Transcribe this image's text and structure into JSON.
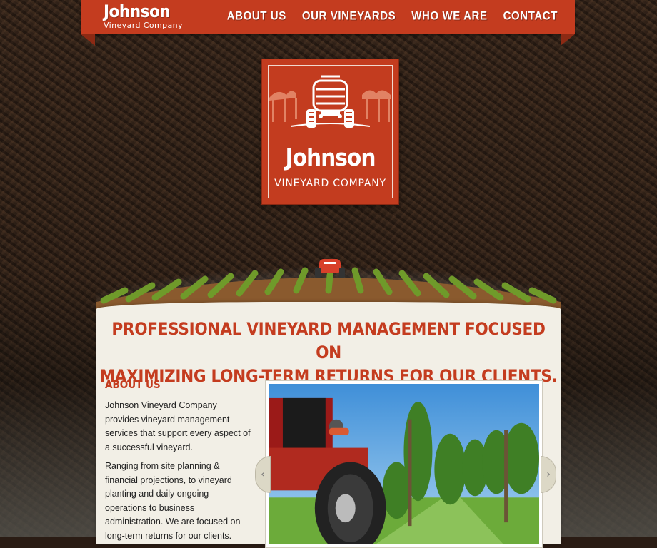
{
  "brand": {
    "name": "Johnson",
    "sub": "Vineyard Company"
  },
  "nav": {
    "items": [
      "ABOUT US",
      "OUR VINEYARDS",
      "WHO WE ARE",
      "CONTACT"
    ]
  },
  "logo": {
    "name": "Johnson",
    "sub": "VINEYARD COMPANY"
  },
  "headline": {
    "line1": "PROFESSIONAL VINEYARD MANAGEMENT FOCUSED ON",
    "line2": "MAXIMIZING LONG-TERM RETURNS FOR OUR CLIENTS."
  },
  "about": {
    "title": "ABOUT US",
    "p1": "Johnson Vineyard Company provides vineyard management services that support every aspect of a successful vineyard.",
    "p2": "Ranging from site planning & financial projections, to vineyard planting and daily ongoing operations to business administration. We are focused on long-term returns for our clients."
  },
  "slider": {
    "prev_icon": "chevron-left-icon",
    "next_icon": "chevron-right-icon",
    "prev_glyph": "‹",
    "next_glyph": "›"
  },
  "colors": {
    "brand_red": "#c43c1f",
    "panel": "#f2efe6",
    "soil": "#2a1c14"
  }
}
